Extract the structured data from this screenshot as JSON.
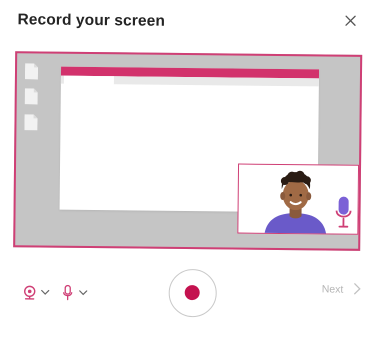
{
  "dialog": {
    "title": "Record your screen"
  },
  "icons": {
    "close": "close-icon",
    "camera": "webcam-icon",
    "mic": "microphone-icon",
    "record": "record-icon",
    "next_chevron": "chevron-right-icon"
  },
  "footer": {
    "next_label": "Next"
  },
  "colors": {
    "accent": "#cf3f75",
    "record_red": "#c4124f",
    "disabled_text": "#b5b5b5"
  }
}
